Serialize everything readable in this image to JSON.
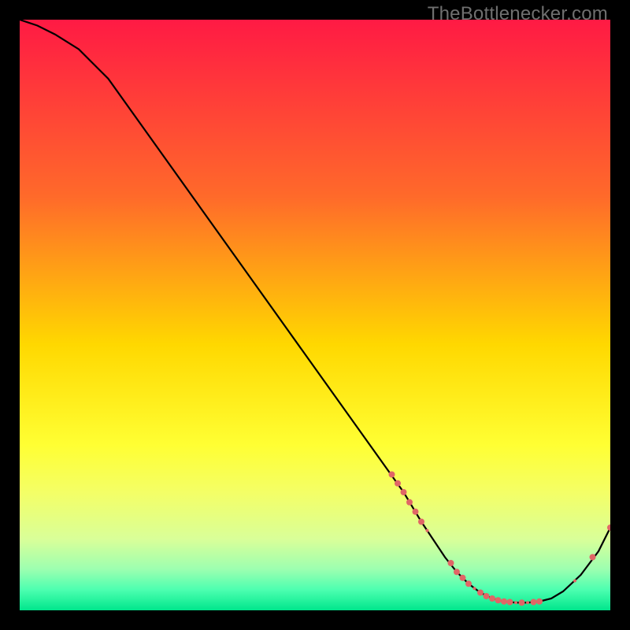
{
  "watermark": "TheBottlenecker.com",
  "chart_data": {
    "type": "line",
    "title": "",
    "xlabel": "",
    "ylabel": "",
    "xlim": [
      0,
      100
    ],
    "ylim": [
      0,
      100
    ],
    "grid": false,
    "x": [
      0,
      3,
      6,
      10,
      15,
      20,
      25,
      30,
      35,
      40,
      45,
      50,
      55,
      60,
      65,
      68,
      70,
      72,
      74,
      76,
      78,
      80,
      82,
      84,
      86,
      88,
      90,
      92,
      95,
      98,
      100
    ],
    "y": [
      100,
      99,
      97.5,
      95,
      90,
      83,
      76,
      69,
      62,
      55,
      48,
      41,
      34,
      27,
      20,
      15,
      12,
      9,
      6.5,
      4.5,
      3,
      2,
      1.5,
      1.3,
      1.3,
      1.5,
      2,
      3.2,
      6,
      10,
      14
    ],
    "markers": {
      "x": [
        63,
        64,
        65,
        66,
        67,
        68,
        69,
        73,
        74,
        75,
        76,
        77,
        78,
        79,
        80,
        81,
        82,
        83,
        84,
        85,
        86,
        87,
        88,
        94,
        97,
        100
      ],
      "y": [
        23,
        21.5,
        20,
        18.3,
        16.7,
        15,
        13.5,
        8,
        6.5,
        5.5,
        4.5,
        3.7,
        3,
        2.4,
        2,
        1.7,
        1.5,
        1.4,
        1.3,
        1.3,
        1.3,
        1.4,
        1.5,
        5,
        9,
        14
      ],
      "size": [
        8,
        8,
        8,
        8,
        8,
        8,
        4,
        8,
        8,
        8,
        8,
        4,
        8,
        8,
        8,
        8,
        8,
        8,
        4,
        8,
        4,
        8,
        8,
        4,
        8,
        8
      ]
    },
    "gradient_stops": [
      {
        "pos": 0.0,
        "color": "#ff1a44"
      },
      {
        "pos": 0.3,
        "color": "#ff6a2a"
      },
      {
        "pos": 0.55,
        "color": "#ffd800"
      },
      {
        "pos": 0.72,
        "color": "#ffff33"
      },
      {
        "pos": 0.8,
        "color": "#f4ff66"
      },
      {
        "pos": 0.88,
        "color": "#d9ff99"
      },
      {
        "pos": 0.93,
        "color": "#9dffb0"
      },
      {
        "pos": 0.965,
        "color": "#4dffb0"
      },
      {
        "pos": 1.0,
        "color": "#00e68c"
      }
    ],
    "marker_color": "#e06666",
    "line_color": "#000000"
  }
}
